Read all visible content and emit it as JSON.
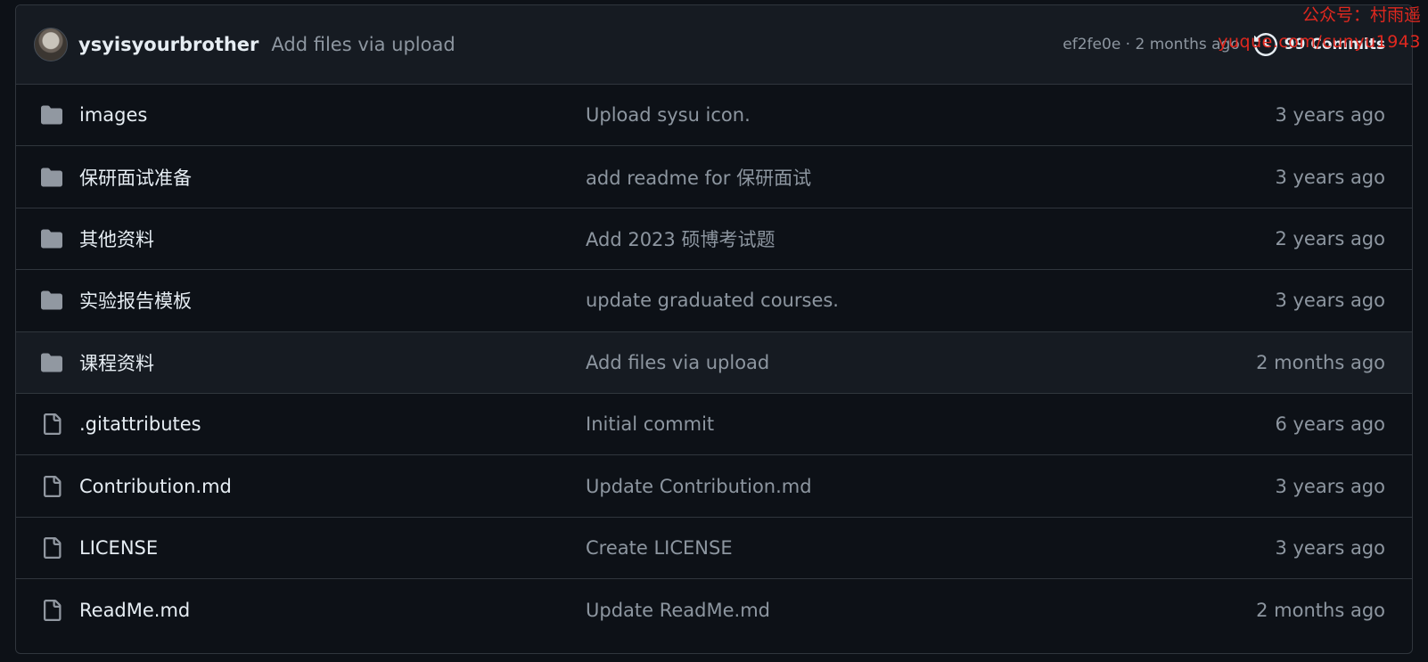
{
  "watermark": {
    "line1": "公众号：村雨遥",
    "line2": "yuque.com/cunyu1943"
  },
  "commit_bar": {
    "author": "ysyisyourbrother",
    "message": "Add files via upload",
    "sha_time": "ef2fe0e · 2 months ago",
    "commits_label": "99 Commits"
  },
  "files": [
    {
      "type": "folder",
      "icon": "folder-icon",
      "name": "images",
      "message": "Upload sysu icon.",
      "time": "3 years ago"
    },
    {
      "type": "folder",
      "icon": "folder-icon",
      "name": "保研面试准备",
      "message": "add readme for 保研面试",
      "time": "3 years ago"
    },
    {
      "type": "folder",
      "icon": "folder-icon",
      "name": "其他资料",
      "message": "Add 2023 硕博考试题",
      "time": "2 years ago"
    },
    {
      "type": "folder",
      "icon": "folder-icon",
      "name": "实验报告模板",
      "message": "update graduated courses.",
      "time": "3 years ago"
    },
    {
      "type": "folder",
      "icon": "folder-icon",
      "name": "课程资料",
      "message": "Add files via upload",
      "time": "2 months ago"
    },
    {
      "type": "file",
      "icon": "file-icon",
      "name": ".gitattributes",
      "message": "Initial commit",
      "time": "6 years ago"
    },
    {
      "type": "file",
      "icon": "file-icon",
      "name": "Contribution.md",
      "message": "Update Contribution.md",
      "time": "3 years ago"
    },
    {
      "type": "file",
      "icon": "file-icon",
      "name": "LICENSE",
      "message": "Create LICENSE",
      "time": "3 years ago"
    },
    {
      "type": "file",
      "icon": "file-icon",
      "name": "ReadMe.md",
      "message": "Update ReadMe.md",
      "time": "2 months ago"
    }
  ],
  "colors": {
    "background": "#0d1117",
    "header_background": "#161b22",
    "border": "#30363d",
    "primary_text": "#e6edf3",
    "muted_text": "#8d96a0",
    "icon": "#9198a1",
    "watermark": "#e0281f"
  }
}
